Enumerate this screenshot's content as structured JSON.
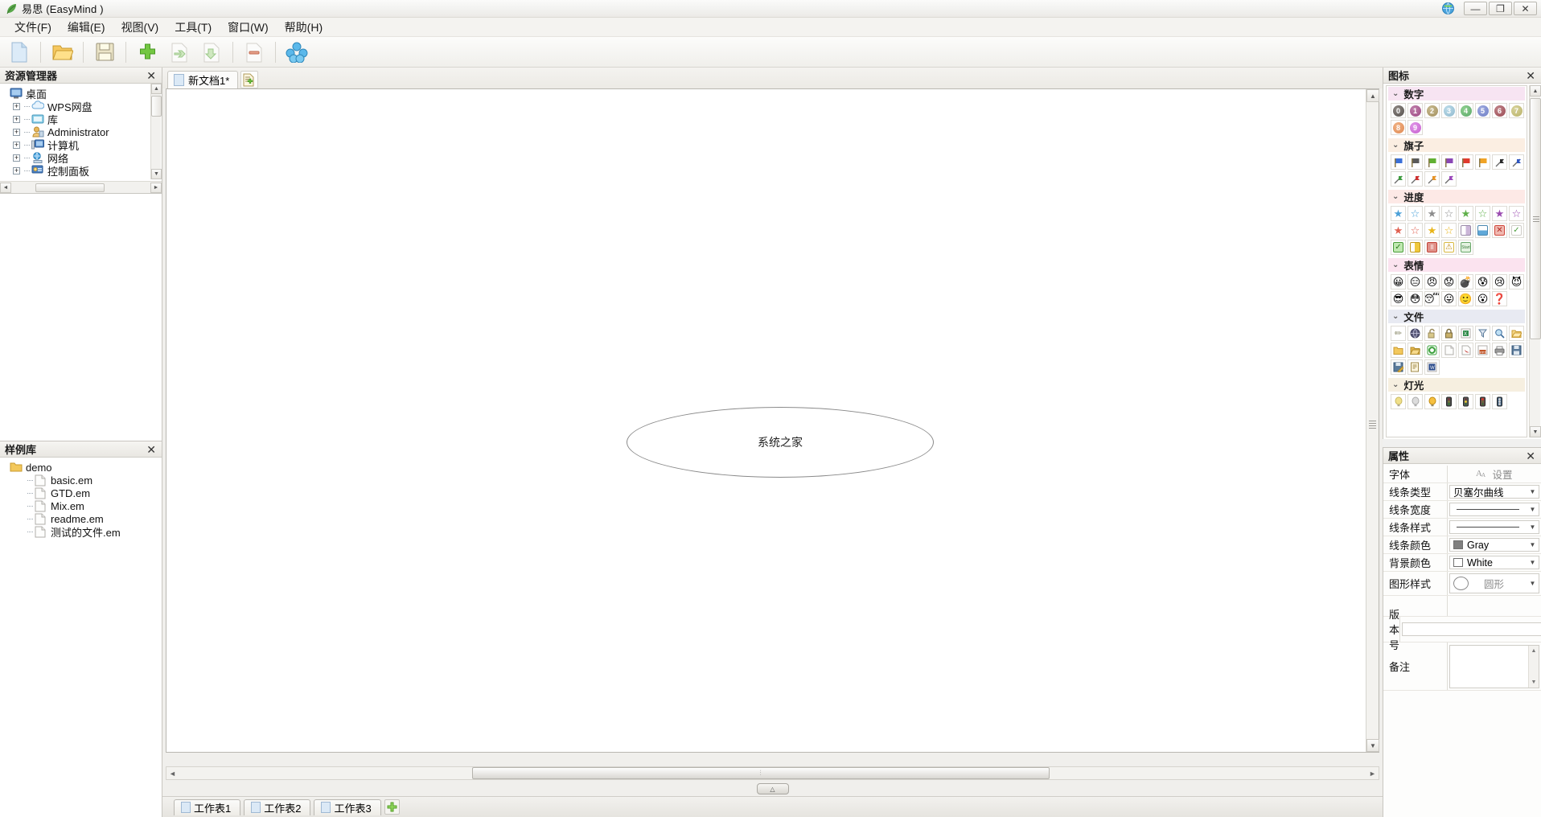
{
  "window": {
    "title": "易思 (EasyMind )",
    "app_icon": "leaf-icon",
    "globe_icon": "globe-icon",
    "minimize_label": "—",
    "maximize_label": "❐",
    "close_label": "✕"
  },
  "menubar": {
    "items": [
      {
        "label": "文件(F)",
        "name": "menu-file"
      },
      {
        "label": "编辑(E)",
        "name": "menu-edit"
      },
      {
        "label": "视图(V)",
        "name": "menu-view"
      },
      {
        "label": "工具(T)",
        "name": "menu-tools"
      },
      {
        "label": "窗口(W)",
        "name": "menu-window"
      },
      {
        "label": "帮助(H)",
        "name": "menu-help"
      }
    ]
  },
  "toolbar": {
    "buttons": [
      {
        "name": "new-document-button",
        "icon": "new-page-icon",
        "title": "新建"
      },
      {
        "name": "open-button",
        "icon": "open-folder-icon",
        "title": "打开"
      },
      {
        "name": "save-button",
        "icon": "floppy-save-icon",
        "title": "保存"
      },
      {
        "name": "add-node-button",
        "icon": "green-plus-icon",
        "title": "添加节点"
      },
      {
        "name": "add-sibling-button",
        "icon": "page-arrow-right-icon",
        "title": "添加同级"
      },
      {
        "name": "add-child-button",
        "icon": "page-arrow-down-icon",
        "title": "添加子级"
      },
      {
        "name": "delete-node-button",
        "icon": "page-minus-icon",
        "title": "删除节点"
      },
      {
        "name": "group-button",
        "icon": "blue-spheres-icon",
        "title": "分组"
      }
    ]
  },
  "explorer": {
    "title": "资源管理器",
    "close_label": "✕",
    "tree": [
      {
        "label": "桌面",
        "icon": "desktop-icon",
        "level": 0,
        "expandable": false
      },
      {
        "label": "WPS网盘",
        "icon": "cloud-icon",
        "level": 1,
        "expandable": true
      },
      {
        "label": "库",
        "icon": "library-icon",
        "level": 1,
        "expandable": true
      },
      {
        "label": "Administrator",
        "icon": "user-icon",
        "level": 1,
        "expandable": true
      },
      {
        "label": "计算机",
        "icon": "computer-icon",
        "level": 1,
        "expandable": true
      },
      {
        "label": "网络",
        "icon": "network-icon",
        "level": 1,
        "expandable": true
      },
      {
        "label": "控制面板",
        "icon": "control-panel-icon",
        "level": 1,
        "expandable": true
      }
    ],
    "expander_plus": "+"
  },
  "samples": {
    "title": "样例库",
    "close_label": "✕",
    "tree": [
      {
        "label": "demo",
        "icon": "folder-icon",
        "level": 0
      },
      {
        "label": "basic.em",
        "icon": "file-icon",
        "level": 2
      },
      {
        "label": "GTD.em",
        "icon": "file-icon",
        "level": 2
      },
      {
        "label": "Mix.em",
        "icon": "file-icon",
        "level": 2
      },
      {
        "label": "readme.em",
        "icon": "file-icon",
        "level": 2
      },
      {
        "label": "测试的文件.em",
        "icon": "file-icon",
        "level": 2
      }
    ]
  },
  "document": {
    "tabs": [
      {
        "label": "新文档1*",
        "icon": "page-icon",
        "active": true
      }
    ],
    "new_tab_button": "new-document-tab-button",
    "node_text": "系统之家"
  },
  "sheets": {
    "tabs": [
      {
        "label": "工作表1"
      },
      {
        "label": "工作表2"
      },
      {
        "label": "工作表3"
      }
    ],
    "add_label": "+"
  },
  "icons_panel": {
    "title": "图标",
    "close_label": "✕",
    "categories": [
      {
        "name": "数字",
        "header_bg": "#f7e4f2",
        "icons": [
          {
            "kind": "num",
            "text": "0",
            "color": "#55504d"
          },
          {
            "kind": "num",
            "text": "1",
            "color": "#9d4a84"
          },
          {
            "kind": "num",
            "text": "2",
            "color": "#a39060"
          },
          {
            "kind": "num",
            "text": "3",
            "color": "#8fb8cc"
          },
          {
            "kind": "num",
            "text": "4",
            "color": "#5da86a"
          },
          {
            "kind": "num",
            "text": "5",
            "color": "#6f7fc4"
          },
          {
            "kind": "num",
            "text": "6",
            "color": "#9a4a52"
          },
          {
            "kind": "num",
            "text": "7",
            "color": "#b9b26a"
          },
          {
            "kind": "num",
            "text": "8",
            "color": "#e08a52"
          },
          {
            "kind": "num",
            "text": "9",
            "color": "#c761cf"
          }
        ]
      },
      {
        "name": "旗子",
        "header_bg": "#fbeee2",
        "icons": [
          {
            "kind": "flag",
            "color": "#3a6fd8"
          },
          {
            "kind": "flag",
            "color": "#5a5a5a"
          },
          {
            "kind": "flag",
            "color": "#61b033"
          },
          {
            "kind": "flag",
            "color": "#8a47b5"
          },
          {
            "kind": "flag",
            "color": "#e03b2e"
          },
          {
            "kind": "flag",
            "color": "#f0a325"
          },
          {
            "kind": "pennant",
            "color": "#2b2b2b"
          },
          {
            "kind": "pennant",
            "color": "#2f56c0"
          },
          {
            "kind": "pennant",
            "color": "#3f9d3f"
          },
          {
            "kind": "pennant",
            "color": "#cf3030"
          },
          {
            "kind": "pennant",
            "color": "#e79326"
          },
          {
            "kind": "pennant",
            "color": "#9b48bb"
          }
        ]
      },
      {
        "name": "进度",
        "header_bg": "#fde9e6",
        "icons": [
          {
            "kind": "star",
            "text": "★",
            "color": "#4aa0d8"
          },
          {
            "kind": "star",
            "text": "☆",
            "color": "#4aa0d8"
          },
          {
            "kind": "star",
            "text": "★",
            "color": "#8c8c8c"
          },
          {
            "kind": "star",
            "text": "☆",
            "color": "#8c8c8c"
          },
          {
            "kind": "star",
            "text": "★",
            "color": "#5fb04a"
          },
          {
            "kind": "star",
            "text": "☆",
            "color": "#5fb04a"
          },
          {
            "kind": "star",
            "text": "★",
            "color": "#9a4bb0"
          },
          {
            "kind": "star",
            "text": "☆",
            "color": "#9a4bb0"
          },
          {
            "kind": "star",
            "text": "★",
            "color": "#e06050"
          },
          {
            "kind": "star",
            "text": "☆",
            "color": "#e06050"
          },
          {
            "kind": "star",
            "text": "★",
            "color": "#e8b418"
          },
          {
            "kind": "star",
            "text": "☆",
            "color": "#e8b418"
          },
          {
            "kind": "sq",
            "text": "",
            "color": "#cbb6d8"
          },
          {
            "kind": "sq",
            "text": "",
            "color": "#5fa8d8"
          },
          {
            "kind": "sq",
            "text": "✕",
            "color": "#d0463a"
          },
          {
            "kind": "sq",
            "text": "✓",
            "color": "#4a9d3a"
          },
          {
            "kind": "sq",
            "text": "✓",
            "color": "#4a9d3a"
          },
          {
            "kind": "sq",
            "text": "",
            "color": "#e8b418"
          },
          {
            "kind": "sq",
            "text": "II",
            "color": "#c2453a"
          },
          {
            "kind": "sq",
            "text": "⚠",
            "color": "#e8b418"
          },
          {
            "kind": "sq",
            "text": "Start",
            "color": "#6aa86a"
          }
        ]
      },
      {
        "name": "表情",
        "header_bg": "#fbe3ef",
        "icons": [
          {
            "kind": "emoji",
            "text": "😀",
            "color": "#f2c83c"
          },
          {
            "kind": "emoji",
            "text": "😑",
            "color": "#f2c83c"
          },
          {
            "kind": "emoji",
            "text": "😠",
            "color": "#e0643c"
          },
          {
            "kind": "emoji",
            "text": "😟",
            "color": "#c9c63c"
          },
          {
            "kind": "emoji",
            "text": "💣",
            "color": "#6a6a6a"
          },
          {
            "kind": "emoji",
            "text": "😰",
            "color": "#6ab4d8"
          },
          {
            "kind": "emoji",
            "text": "😢",
            "color": "#f2c83c"
          },
          {
            "kind": "emoji",
            "text": "😈",
            "color": "#c23a3a"
          },
          {
            "kind": "emoji",
            "text": "😎",
            "color": "#d8c83c"
          },
          {
            "kind": "emoji",
            "text": "😳",
            "color": "#e8913c"
          },
          {
            "kind": "emoji",
            "text": "😴",
            "color": "#f2d03c"
          },
          {
            "kind": "emoji",
            "text": "😛",
            "color": "#f2c83c"
          },
          {
            "kind": "emoji",
            "text": "🙂",
            "color": "#f2c83c"
          },
          {
            "kind": "emoji",
            "text": "😮",
            "color": "#e0a03c"
          },
          {
            "kind": "emoji",
            "text": "❓",
            "color": "#e8d060"
          }
        ]
      },
      {
        "name": "文件",
        "header_bg": "#e8eaf2",
        "icons": [
          {
            "kind": "gl",
            "text": "✏",
            "color": "#8a8a7a"
          },
          {
            "kind": "gl",
            "text": "⬤",
            "color": "#4a4a6a"
          },
          {
            "kind": "gl",
            "text": "🔓",
            "color": "#9a8a5a"
          },
          {
            "kind": "gl",
            "text": "🔒",
            "color": "#7a6a3a"
          },
          {
            "kind": "gl",
            "text": "▤",
            "color": "#2f8a4a"
          },
          {
            "kind": "gl",
            "text": "▼",
            "color": "#5a7a9a"
          },
          {
            "kind": "gl",
            "text": "🔍",
            "color": "#3a6a9a"
          },
          {
            "kind": "gl",
            "text": "📂",
            "color": "#e0a83c"
          },
          {
            "kind": "gl",
            "text": "📁",
            "color": "#e8b84c"
          },
          {
            "kind": "gl",
            "text": "📂",
            "color": "#d8a038"
          },
          {
            "kind": "gl",
            "text": "◯",
            "color": "#3aa03a"
          },
          {
            "kind": "gl",
            "text": "📄",
            "color": "#bdbdbd"
          },
          {
            "kind": "gl",
            "text": "A",
            "color": "#c2302a"
          },
          {
            "kind": "gl",
            "text": "P",
            "color": "#c2562a"
          },
          {
            "kind": "gl",
            "text": "🖨",
            "color": "#6a6a6a"
          },
          {
            "kind": "gl",
            "text": "💾",
            "color": "#4a6a8a"
          },
          {
            "kind": "gl",
            "text": "▣",
            "color": "#4a6a8a"
          },
          {
            "kind": "gl",
            "text": "▤",
            "color": "#a08a4a"
          },
          {
            "kind": "gl",
            "text": "W",
            "color": "#2a4a8a"
          }
        ]
      },
      {
        "name": "灯光",
        "header_bg": "#f6efe0",
        "icons": [
          {
            "kind": "gl",
            "text": "💡",
            "color": "#e0d060"
          },
          {
            "kind": "gl",
            "text": "💡",
            "color": "#c8c8c8"
          },
          {
            "kind": "gl",
            "text": "💡",
            "color": "#e8a030"
          },
          {
            "kind": "gl",
            "text": "🚦",
            "color": "#4a4a4a"
          },
          {
            "kind": "gl",
            "text": "🚦",
            "color": "#5a5a5a"
          },
          {
            "kind": "gl",
            "text": "🚦",
            "color": "#6a4a4a"
          },
          {
            "kind": "gl",
            "text": "🚦",
            "color": "#3a5a7a"
          }
        ]
      }
    ]
  },
  "properties": {
    "title": "属性",
    "close_label": "✕",
    "rows": [
      {
        "label": "字体",
        "type": "font",
        "value": "设置",
        "name": "font-setting"
      },
      {
        "label": "线条类型",
        "type": "combo",
        "value": "贝塞尔曲线",
        "name": "line-type"
      },
      {
        "label": "线条宽度",
        "type": "line",
        "value": "",
        "name": "line-width"
      },
      {
        "label": "线条样式",
        "type": "line",
        "value": "",
        "name": "line-style"
      },
      {
        "label": "线条颜色",
        "type": "color",
        "value": "Gray",
        "color": "#808080",
        "name": "line-color"
      },
      {
        "label": "背景颜色",
        "type": "color",
        "value": "White",
        "color": "#ffffff",
        "name": "background-color"
      },
      {
        "label": "图形样式",
        "type": "shape",
        "value": "圆形",
        "name": "shape-style"
      }
    ],
    "version_label": "版本号",
    "version_value": "",
    "note_label": "备注",
    "note_value": ""
  },
  "scrollbars": {
    "left_arrow": "◄",
    "right_arrow": "►",
    "up_arrow": "▲",
    "down_arrow": "▼",
    "splitter_glyph": "△",
    "grip_glyph": "⫶"
  }
}
